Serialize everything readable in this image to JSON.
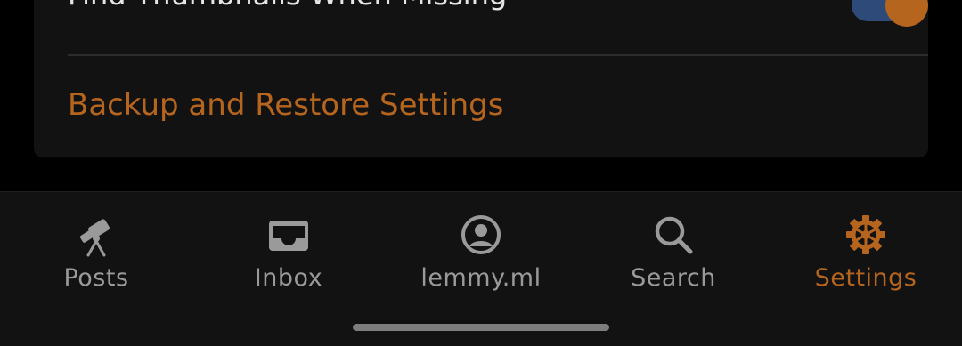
{
  "settings": {
    "thumbnail_toggle_label": "Find Thumbnails When Missing",
    "thumbnail_toggle_on": true,
    "backup_link_label": "Backup and Restore Settings"
  },
  "bottom_nav": {
    "items": [
      {
        "label": "Posts",
        "icon": "telescope-icon"
      },
      {
        "label": "Inbox",
        "icon": "inbox-icon"
      },
      {
        "label": "lemmy.ml",
        "icon": "account-circle-icon"
      },
      {
        "label": "Search",
        "icon": "search-icon"
      },
      {
        "label": "Settings",
        "icon": "gear-icon"
      }
    ],
    "active_index": 4
  },
  "colors": {
    "accent": "#b5651d",
    "toggle_track": "#2d4a78",
    "background": "#000000",
    "surface": "#121212",
    "inactive": "#9a9a9a"
  }
}
